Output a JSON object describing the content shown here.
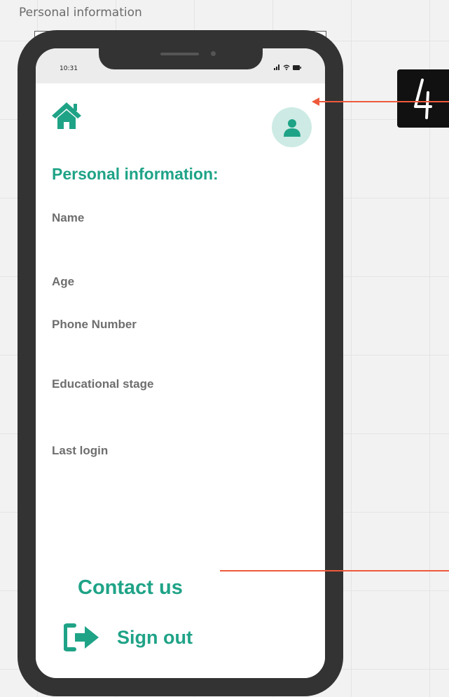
{
  "frame": {
    "label": "Personal information"
  },
  "status_bar": {
    "time": "10:31"
  },
  "header": {
    "home_icon": "home-icon",
    "profile_icon": "user-icon"
  },
  "main": {
    "title": "Personal information:",
    "fields": [
      {
        "label": "Name"
      },
      {
        "label": "Age"
      },
      {
        "label": "Phone Number"
      },
      {
        "label": "Educational stage"
      },
      {
        "label": "Last login"
      }
    ]
  },
  "footer": {
    "contact_label": "Contact us",
    "signout_label": "Sign out",
    "signout_icon": "sign-out-icon"
  },
  "annotation": {
    "badge_text": "4"
  },
  "colors": {
    "accent": "#1fa387",
    "accent_light": "#cdebe4",
    "phone_body": "#333333",
    "label_gray": "#6e6e6e",
    "annotation_arrow": "#ee5a3c"
  }
}
